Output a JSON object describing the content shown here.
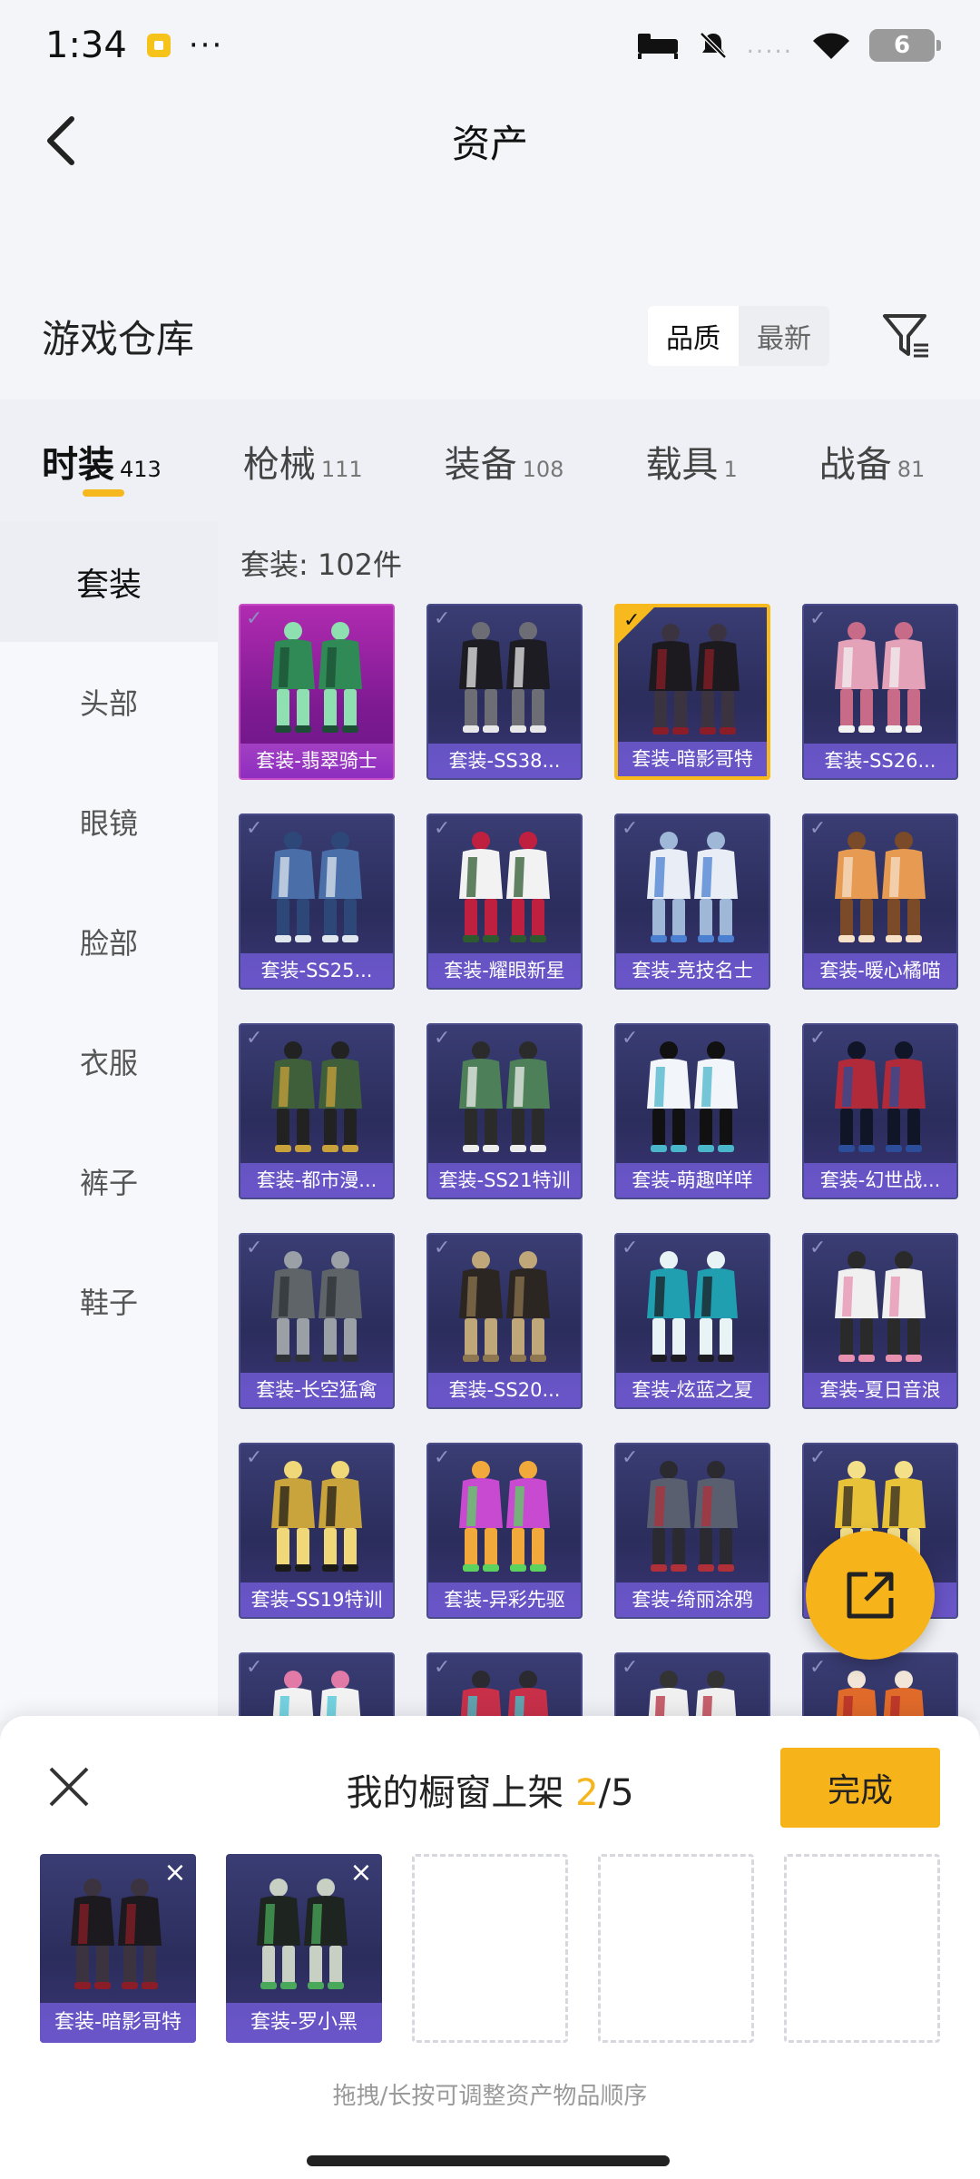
{
  "status_bar": {
    "time": "1:34",
    "more": "···",
    "battery": "6",
    "signal_dots": "....."
  },
  "header": {
    "title": "资产"
  },
  "warehouse": {
    "title": "游戏仓库",
    "sort_options": [
      "品质",
      "最新"
    ],
    "active_sort": "品质"
  },
  "category_tabs": [
    {
      "label": "时装",
      "count": "413",
      "active": true
    },
    {
      "label": "枪械",
      "count": "111",
      "active": false
    },
    {
      "label": "装备",
      "count": "108",
      "active": false
    },
    {
      "label": "载具",
      "count": "1",
      "active": false
    },
    {
      "label": "战备",
      "count": "81",
      "active": false
    }
  ],
  "sidebar": {
    "items": [
      "套装",
      "头部",
      "眼镜",
      "脸部",
      "衣服",
      "裤子",
      "鞋子"
    ],
    "active": "套装"
  },
  "grid": {
    "count_label": "套装: 102件",
    "items": [
      {
        "label": "套装-翡翠骑士",
        "style": "pink",
        "selected": false,
        "art": "green"
      },
      {
        "label": "套装-SS38...",
        "style": "normal",
        "selected": false,
        "art": "black-white"
      },
      {
        "label": "套装-暗影哥特",
        "style": "normal",
        "selected": true,
        "art": "dark-red"
      },
      {
        "label": "套装-SS26...",
        "style": "normal",
        "selected": false,
        "art": "pink"
      },
      {
        "label": "套装-SS25...",
        "style": "normal",
        "selected": false,
        "art": "blue-denim"
      },
      {
        "label": "套装-耀眼新星",
        "style": "normal",
        "selected": false,
        "art": "white-green"
      },
      {
        "label": "套装-竞技名士",
        "style": "normal",
        "selected": false,
        "art": "white-blue"
      },
      {
        "label": "套装-暖心橘喵",
        "style": "normal",
        "selected": false,
        "art": "orange"
      },
      {
        "label": "套装-都市漫...",
        "style": "normal",
        "selected": false,
        "art": "olive"
      },
      {
        "label": "套装-SS21特训",
        "style": "normal",
        "selected": false,
        "art": "green-grey"
      },
      {
        "label": "套装-萌趣咩咩",
        "style": "normal",
        "selected": false,
        "art": "white-teal"
      },
      {
        "label": "套装-幻世战...",
        "style": "normal",
        "selected": false,
        "art": "red-blue"
      },
      {
        "label": "套装-长空猛禽",
        "style": "normal",
        "selected": false,
        "art": "camo"
      },
      {
        "label": "套装-SS20...",
        "style": "normal",
        "selected": false,
        "art": "brown"
      },
      {
        "label": "套装-炫蓝之夏",
        "style": "normal",
        "selected": false,
        "art": "teal-black"
      },
      {
        "label": "套装-夏日音浪",
        "style": "normal",
        "selected": false,
        "art": "white-pink"
      },
      {
        "label": "套装-SS19特训",
        "style": "normal",
        "selected": false,
        "art": "gold"
      },
      {
        "label": "套装-异彩先驱",
        "style": "normal",
        "selected": false,
        "art": "colorful"
      },
      {
        "label": "套装-绮丽涂鸦",
        "style": "normal",
        "selected": false,
        "art": "grey-red"
      },
      {
        "label": "套装-...巩",
        "style": "normal",
        "selected": false,
        "art": "yellow"
      },
      {
        "label": "",
        "style": "normal",
        "selected": false,
        "art": "white-cyan"
      },
      {
        "label": "",
        "style": "normal",
        "selected": false,
        "art": "red-cyan"
      },
      {
        "label": "",
        "style": "normal",
        "selected": false,
        "art": "white-red"
      },
      {
        "label": "",
        "style": "normal",
        "selected": false,
        "art": "orange-red"
      }
    ]
  },
  "fab": {
    "icon": "share-icon"
  },
  "showcase": {
    "title_prefix": "我的橱窗上架 ",
    "current": "2",
    "total": "/5",
    "done_label": "完成",
    "slots": [
      {
        "label": "套装-暗影哥特",
        "art": "dark-red",
        "filled": true
      },
      {
        "label": "套装-罗小黑",
        "art": "black-green",
        "filled": true
      },
      {
        "label": "",
        "filled": false
      },
      {
        "label": "",
        "filled": false
      },
      {
        "label": "",
        "filled": false
      }
    ],
    "hint": "拖拽/长按可调整资产物品顺序",
    "remove_label": "×"
  },
  "colors": {
    "accent": "#f7b41a",
    "card": "#2b2d5c",
    "card_label": "#6a55c8",
    "rare": "#9a2aa8"
  }
}
